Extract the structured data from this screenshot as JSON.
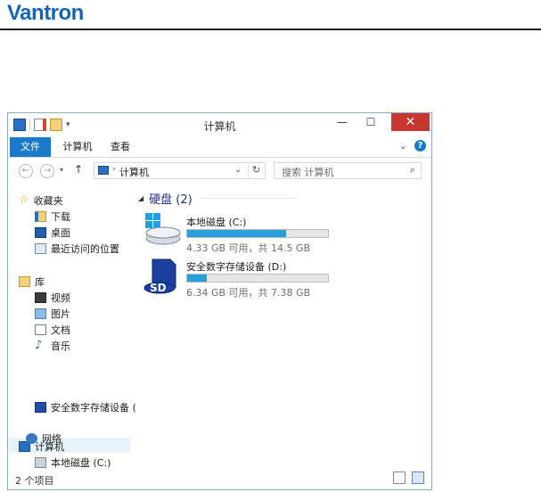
{
  "brand": "Vantron",
  "window": {
    "title": "计算机",
    "controls": {
      "minimize": "—",
      "maximize": "☐",
      "close": "✕"
    }
  },
  "ribbon": {
    "tabs": [
      "文件",
      "计算机",
      "查看"
    ],
    "expand": "⌄",
    "help": "?"
  },
  "address": {
    "path": "计算机",
    "search_placeholder": "搜索 计算机"
  },
  "nav": {
    "favorites": {
      "label": "收藏夹",
      "items": [
        "下载",
        "桌面",
        "最近访问的位置"
      ]
    },
    "libraries": {
      "label": "库",
      "items": [
        "视频",
        "图片",
        "文档",
        "音乐"
      ]
    },
    "computer": {
      "label": "计算机",
      "items": [
        "本地磁盘 (C:)",
        "安全数字存储设备 ("
      ]
    },
    "network": "网络"
  },
  "main": {
    "group_header": "硬盘 (2)",
    "drives": [
      {
        "name": "本地磁盘 (C:)",
        "info": "4.33 GB 可用，共 14.5 GB",
        "used_fraction": 0.7
      },
      {
        "name": "安全数字存储设备 (D:)",
        "info": "6.34 GB 可用，共 7.38 GB",
        "used_fraction": 0.14
      }
    ]
  },
  "status": {
    "item_count": "2 个项目"
  },
  "colors": {
    "accent": "#1979ca",
    "bar_fill": "#26a0da",
    "close": "#c7362f",
    "brand": "#1565b5"
  }
}
